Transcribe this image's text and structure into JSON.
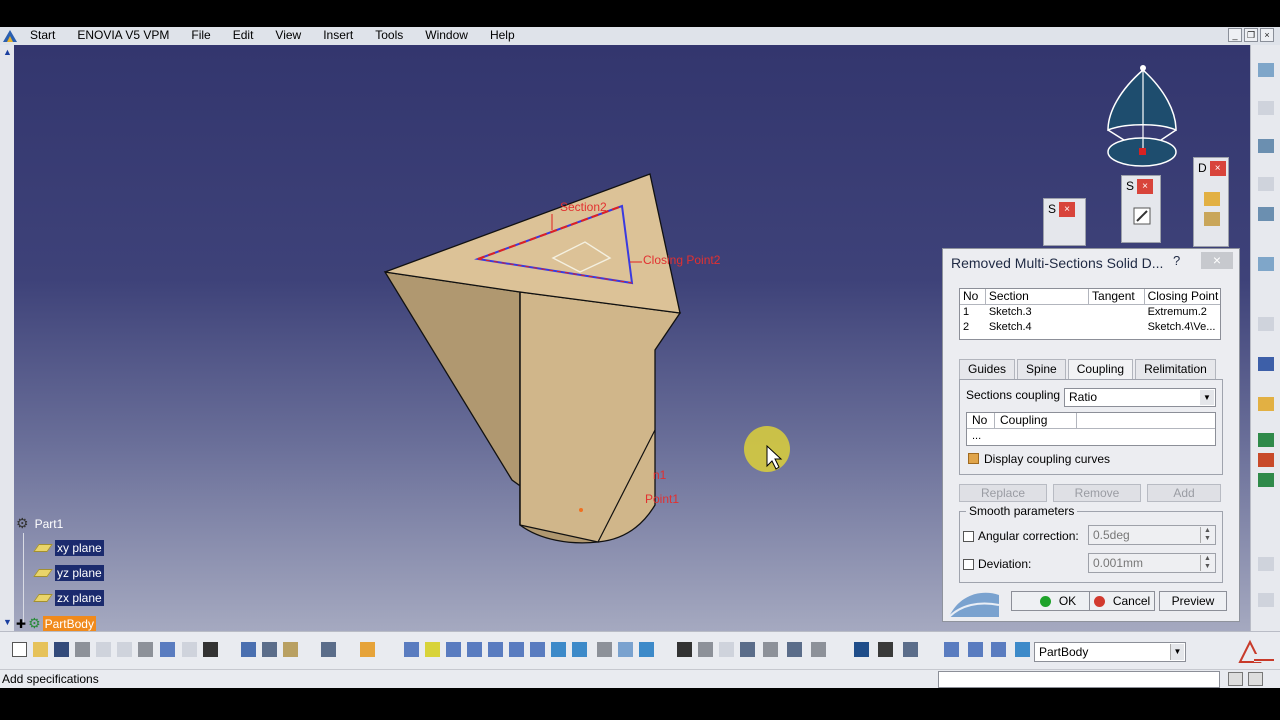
{
  "menubar": {
    "items": [
      "Start",
      "ENOVIA V5 VPM",
      "File",
      "Edit",
      "View",
      "Insert",
      "Tools",
      "Window",
      "Help"
    ]
  },
  "viewport": {
    "annotations": {
      "section": "Section2",
      "closing_point": "Closing Point2",
      "point_a": "n1",
      "point_b": "Point1"
    }
  },
  "tree": {
    "root": "Part1",
    "items": [
      {
        "label": "xy plane"
      },
      {
        "label": "yz plane"
      },
      {
        "label": "zx plane"
      },
      {
        "label": "PartBody"
      }
    ]
  },
  "mini_toolbars": [
    {
      "title": "S"
    },
    {
      "title": "S"
    },
    {
      "title": "D"
    }
  ],
  "dialog": {
    "title": "Removed Multi-Sections Solid D...",
    "help": "?",
    "close": "×",
    "sections_table": {
      "headers": [
        "No",
        "Section",
        "Tangent",
        "Closing Point"
      ],
      "rows": [
        [
          "1",
          "Sketch.3",
          "",
          "Extremum.2"
        ],
        [
          "2",
          "Sketch.4",
          "",
          "Sketch.4\\Ve..."
        ]
      ]
    },
    "tabs": [
      "Guides",
      "Spine",
      "Coupling",
      "Relimitation"
    ],
    "active_tab": "Coupling",
    "sections_coupling_label": "Sections coupling :",
    "sections_coupling_value": "Ratio",
    "coupling_table": {
      "headers": [
        "No",
        "Coupling"
      ],
      "rows": [
        "..."
      ]
    },
    "display_coupling_curves": "Display coupling curves",
    "buttons": {
      "replace": "Replace",
      "remove": "Remove",
      "add": "Add"
    },
    "smooth_parameters": {
      "title": "Smooth parameters",
      "angular_label": "Angular correction:",
      "angular_value": "0.5deg",
      "deviation_label": "Deviation:",
      "deviation_value": "0.001mm"
    },
    "footer": {
      "ok": "OK",
      "cancel": "Cancel",
      "preview": "Preview"
    },
    "colors": {
      "ok_dot": "#1fa32b",
      "cancel_dot": "#d23a2f"
    }
  },
  "bottom_toolbar": {
    "select_value": "PartBody"
  },
  "status": {
    "text": "Add specifications"
  }
}
